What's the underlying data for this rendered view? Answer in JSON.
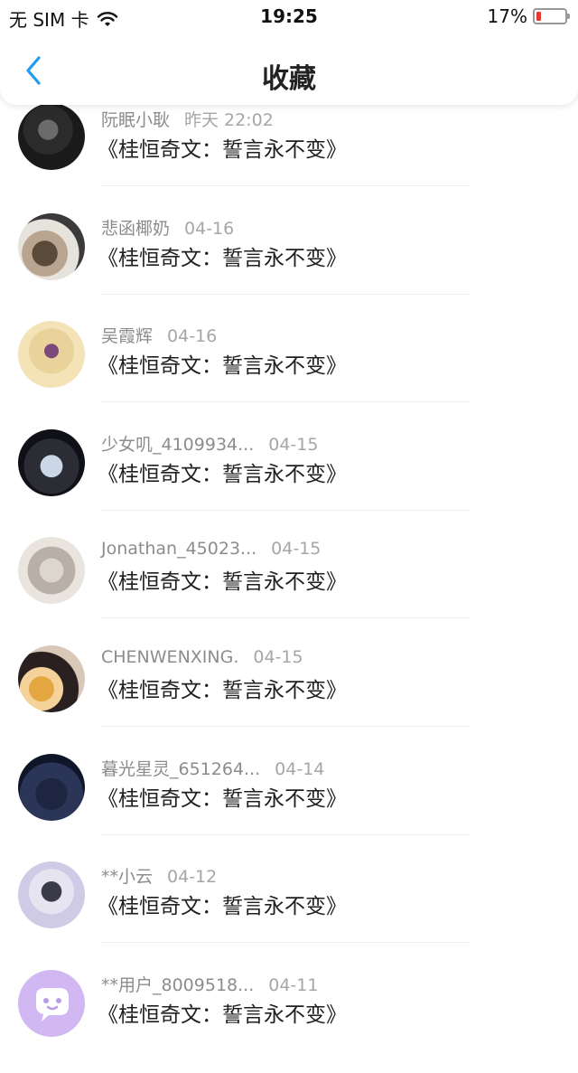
{
  "status_bar": {
    "carrier": "无 SIM 卡",
    "time": "19:25",
    "battery": "17%",
    "battery_level": 0.17,
    "battery_color": "#e53935"
  },
  "header": {
    "back_icon": "chevron-left-icon",
    "title": "收藏",
    "accent": "#1f9bf0"
  },
  "items": [
    {
      "name": "阮眠小耿",
      "date": "昨天 22:02",
      "title": "《桂恒奇文：誓言永不变》"
    },
    {
      "name": "悲函椰奶",
      "date": "04-16",
      "title": "《桂恒奇文：誓言永不变》"
    },
    {
      "name": "吴霞辉",
      "date": "04-16",
      "title": "《桂恒奇文：誓言永不变》"
    },
    {
      "name": "少女叽_4109934...",
      "date": "04-15",
      "title": "《桂恒奇文：誓言永不变》"
    },
    {
      "name": "Jonathan_45023...",
      "date": "04-15",
      "title": "《桂恒奇文：誓言永不变》"
    },
    {
      "name": "CHENWENXING.",
      "date": "04-15",
      "title": "《桂恒奇文：誓言永不变》"
    },
    {
      "name": "暮光星灵_651264...",
      "date": "04-14",
      "title": "《桂恒奇文：誓言永不变》"
    },
    {
      "name": "**小云",
      "date": "04-12",
      "title": "《桂恒奇文：誓言永不变》"
    },
    {
      "name": "**用户_8009518...",
      "date": "04-11",
      "title": "《桂恒奇文：誓言永不变》"
    }
  ]
}
